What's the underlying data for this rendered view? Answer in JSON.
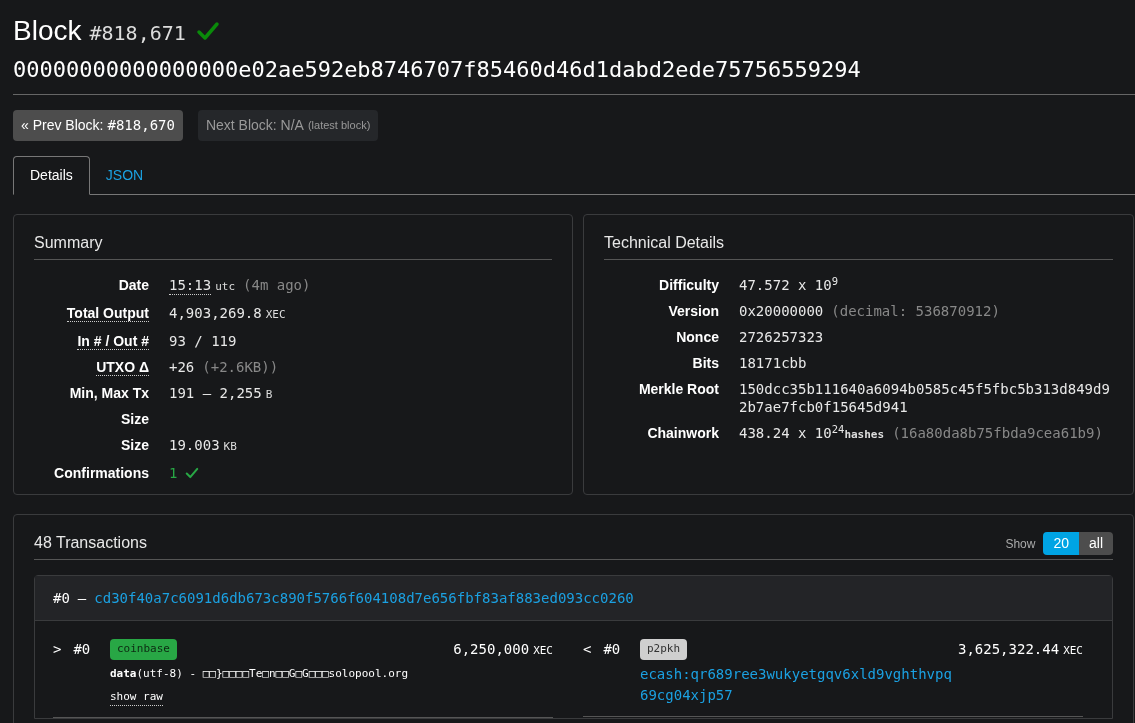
{
  "header": {
    "title": "Block",
    "height": "#818,671",
    "valid": true,
    "hash": "00000000000000000e02ae592eb8746707f85460d46d1dabd2ede75756559294"
  },
  "nav": [
    {
      "kind": "prev",
      "label": "« Prev Block:",
      "value": "#818,670",
      "disabled": false
    },
    {
      "kind": "next",
      "label": "Next Block: N/A",
      "note": "(latest block)",
      "disabled": true
    }
  ],
  "tabs": [
    {
      "label": "Details",
      "selected": true
    },
    {
      "label": "JSON",
      "selected": false
    }
  ],
  "summary": {
    "title": "Summary",
    "rows": [
      {
        "label": "Date",
        "tooltip": false,
        "value": "15:13",
        "value_tooltip": true,
        "unit": "utc",
        "note": "(4m ago)"
      },
      {
        "label": "Total Output",
        "tooltip": true,
        "value": "4,903,269.8",
        "unit": "XEC"
      },
      {
        "label": "In # / Out #",
        "tooltip": true,
        "value": "93 / 119"
      },
      {
        "label": "UTXO Δ",
        "tooltip": true,
        "value": "+26",
        "note": "(+2.6KB))"
      },
      {
        "label": "Min, Max Tx Size",
        "tooltip": false,
        "value": "191 – 2,255",
        "unit": "B"
      },
      {
        "label": "Size",
        "tooltip": false,
        "value": "19.003",
        "unit": "KB"
      },
      {
        "label": "Confirmations",
        "tooltip": false,
        "value": "1",
        "confirmed": true
      }
    ]
  },
  "technical": {
    "title": "Technical Details",
    "rows": [
      {
        "label": "Difficulty",
        "value": "47.572 x 10$^{9}$"
      },
      {
        "label": "Version",
        "value": "0x20000000",
        "note": "(decimal: 536870912)"
      },
      {
        "label": "Nonce",
        "value": "2726257323"
      },
      {
        "label": "Bits",
        "value": "18171cbb"
      },
      {
        "label": "Merkle Root",
        "value": "150dcc35b111640a6094b0585c45f5fbc5b313d849d92b7ae7fcb0f15645d941"
      },
      {
        "label": "Chainwork",
        "value": "438.24 x 10$^{24}$",
        "unit": "hashes",
        "note": "(16a80da8b75fbda9cea61b9)"
      }
    ]
  },
  "transactions": {
    "title": "48 Transactions",
    "show_label": "Show",
    "show_options": [
      {
        "label": "20",
        "selected": true
      },
      {
        "label": "all",
        "selected": false
      }
    ],
    "items": [
      {
        "index": "#0",
        "dash": "–",
        "txid": "cd30f40a7c6091d6db673c890f5766f604108d7e656fbf83af883ed093cc0260",
        "inputs": [
          {
            "arrow": ">",
            "index": "#0",
            "kind": "coinbase",
            "tag": "coinbase",
            "amount": "6,250,000",
            "unit": "XEC",
            "data": "**data**(utf-8) - □□}□□□□Te□n□□G□G□□□solopool.org",
            "show_raw": "show raw"
          }
        ],
        "outputs": [
          {
            "arrow": "<",
            "index": "#0",
            "kind": "p2pkh",
            "tag": "p2pkh",
            "amount": "3,625,322.44",
            "unit": "XEC",
            "address": "ecash:qr689ree3wukyetgqv6xld9vghthvpq69cg04xjp57"
          }
        ]
      }
    ]
  }
}
